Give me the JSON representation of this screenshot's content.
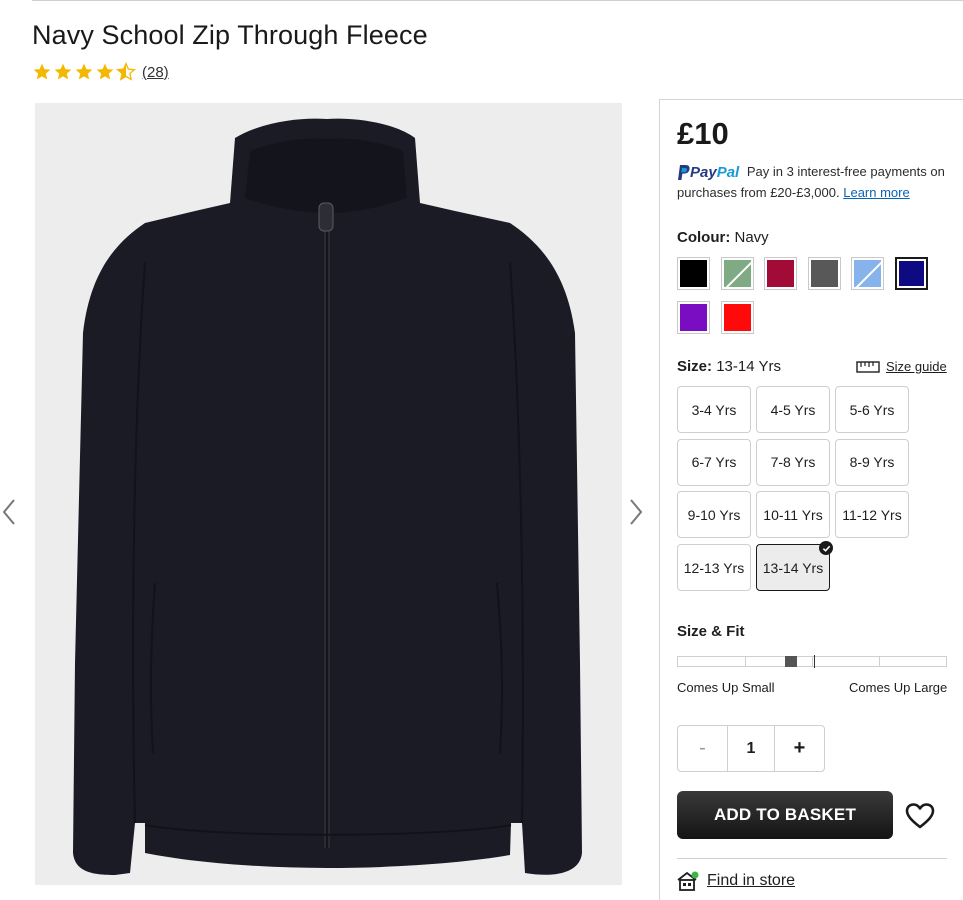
{
  "product": {
    "title": "Navy School Zip Through Fleece",
    "rating": 4.5,
    "review_count": "(28)",
    "price": "£10"
  },
  "paypal": {
    "brand_pay": "Pay",
    "brand_pal": "Pal",
    "message": "Pay in 3 interest-free payments on purchases from £20-£3,000.",
    "learn_more": "Learn more"
  },
  "colour": {
    "label": "Colour:",
    "value": "Navy",
    "swatches": [
      {
        "name": "black",
        "color": "#000000",
        "striked": false,
        "selected": false
      },
      {
        "name": "green",
        "color": "#7faa84",
        "striked": true,
        "selected": false
      },
      {
        "name": "burgundy",
        "color": "#a10b36",
        "striked": false,
        "selected": false
      },
      {
        "name": "grey",
        "color": "#585858",
        "striked": false,
        "selected": false
      },
      {
        "name": "light-blue",
        "color": "#87b3ec",
        "striked": true,
        "selected": false
      },
      {
        "name": "navy",
        "color": "#0d0a82",
        "striked": false,
        "selected": true
      },
      {
        "name": "purple",
        "color": "#7a0cc1",
        "striked": false,
        "selected": false
      },
      {
        "name": "red",
        "color": "#ff0a0a",
        "striked": false,
        "selected": false
      }
    ]
  },
  "size": {
    "label": "Size:",
    "value": "13-14 Yrs",
    "guide": "Size guide",
    "options": [
      "3-4 Yrs",
      "4-5 Yrs",
      "5-6 Yrs",
      "6-7 Yrs",
      "7-8 Yrs",
      "8-9 Yrs",
      "9-10 Yrs",
      "10-11 Yrs",
      "11-12 Yrs",
      "12-13 Yrs",
      "13-14 Yrs"
    ],
    "selected": "13-14 Yrs"
  },
  "fit": {
    "label": "Size & Fit",
    "min_label": "Comes Up Small",
    "max_label": "Comes Up Large",
    "level": 0.42
  },
  "quantity": {
    "minus": "-",
    "value": "1",
    "plus": "+"
  },
  "actions": {
    "add_to_basket": "ADD TO BASKET",
    "find_in_store": "Find in store"
  },
  "colors": {
    "star": "#f5b800",
    "paypal_dark": "#253b80",
    "paypal_light": "#179bd7",
    "link": "#0a64b4",
    "fleece": "#1b1b26"
  }
}
